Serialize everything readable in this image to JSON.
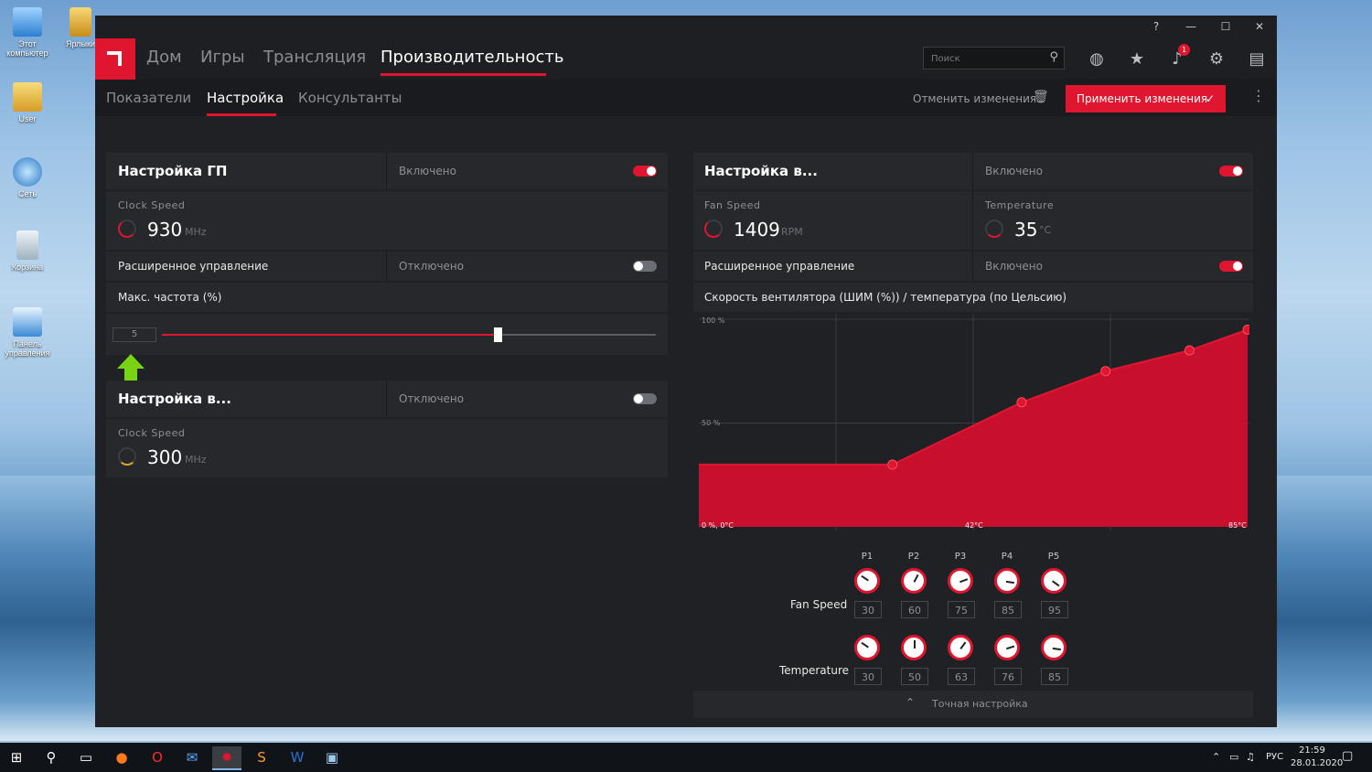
{
  "desktop": {
    "icons": [
      {
        "label": "Этот компьютер",
        "icon": "computer-icon"
      },
      {
        "label": "Ярлыки",
        "icon": "folder-icon"
      },
      {
        "label": "User",
        "icon": "user-folder-icon"
      },
      {
        "label": "Сеть",
        "icon": "network-icon"
      },
      {
        "label": "Корзина",
        "icon": "recycle-bin-icon"
      },
      {
        "label": "Панель управления",
        "icon": "control-panel-icon"
      }
    ]
  },
  "window": {
    "titlebar": {
      "help": "?",
      "minimize": "—",
      "maximize": "☐",
      "close": "✕"
    },
    "nav": {
      "items": [
        "Дом",
        "Игры",
        "Трансляция",
        "Производительность"
      ],
      "active": "Производительность",
      "search_placeholder": "Поиск",
      "notification_count": "1",
      "icons": [
        "globe-icon",
        "star-icon",
        "bell-icon",
        "gear-icon",
        "sidebar-icon"
      ]
    },
    "subnav": {
      "items": [
        "Показатели",
        "Настройка",
        "Консультанты"
      ],
      "active": "Настройка",
      "discard_label": "Отменить изменения",
      "apply_label": "Применить изменения"
    },
    "gpu_panel": {
      "title": "Настройка ГП",
      "state": "Включено",
      "clock_label": "Clock Speed",
      "clock_value": "930",
      "clock_unit": "MHz",
      "advanced_label": "Расширенное управление",
      "advanced_state": "Отключено",
      "max_freq_label": "Макс. частота (%)",
      "slider_value": "5",
      "slider_fraction": 0.68
    },
    "vram_panel": {
      "title": "Настройка в...",
      "state": "Отключено",
      "clock_label": "Clock Speed",
      "clock_value": "300",
      "clock_unit": "MHz"
    },
    "fan_panel": {
      "title": "Настройка в...",
      "state": "Включено",
      "fan_label": "Fan Speed",
      "fan_value": "1409",
      "fan_unit": "RPM",
      "temp_label": "Temperature",
      "temp_value": "35",
      "temp_unit": "°C",
      "advanced_label": "Расширенное управление",
      "advanced_state": "Включено",
      "curve_label": "Скорость вентилятора (ШИМ (%)) / температура (по Цельсию)",
      "fine_tune_label": "Точная настройка"
    },
    "chart_data": {
      "type": "area",
      "title": "",
      "x": [
        0,
        30,
        50,
        63,
        76,
        85
      ],
      "y": [
        30,
        30,
        60,
        75,
        85,
        95
      ],
      "xlim": [
        0,
        85
      ],
      "ylim": [
        0,
        100
      ],
      "tick_labels": {
        "y_top": "100 %",
        "y_mid": "50 %",
        "origin": "0 %, 0°C",
        "x_mid": "42°C",
        "x_end": "85°C"
      },
      "color": "#c8102e"
    },
    "points": {
      "names": [
        "P1",
        "P2",
        "P3",
        "P4",
        "P5"
      ],
      "fan_speed_label": "Fan Speed",
      "temperature_label": "Temperature",
      "fan_speed": [
        "30",
        "60",
        "75",
        "85",
        "95"
      ],
      "temperature": [
        "30",
        "50",
        "63",
        "76",
        "85"
      ]
    }
  },
  "taskbar": {
    "lang": "РУС",
    "time": "21:59",
    "date": "28.01.2020",
    "apps": [
      "windows-start-icon",
      "search-icon",
      "task-view-icon",
      "firefox-icon",
      "opera-icon",
      "mail-icon",
      "radeon-icon",
      "sublime-icon",
      "word-icon",
      "notepad-icon"
    ]
  },
  "colors": {
    "accent": "#e0152f",
    "panel": "#26282b",
    "bg": "#1f2124"
  }
}
